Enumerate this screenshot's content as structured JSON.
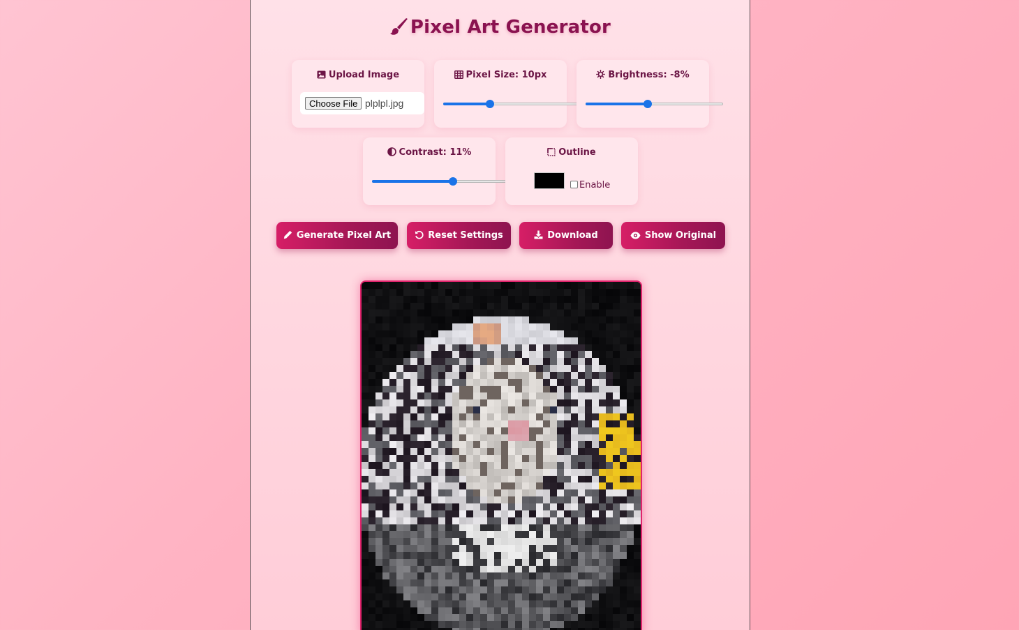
{
  "app": {
    "title": "Pixel Art Generator",
    "accent_color": "#d61e66",
    "title_icon": "paintbrush-icon"
  },
  "controls": {
    "upload": {
      "label": "Upload Image",
      "icon": "image-icon",
      "button_label": "Choose File",
      "file_name": "plplpl.jpg"
    },
    "pixel_size": {
      "label": "Pixel Size: 10px",
      "icon": "grid-icon",
      "value_fraction": 0.34
    },
    "brightness": {
      "label": "Brightness: -8%",
      "icon": "sun-icon",
      "value_fraction": 0.45
    },
    "contrast": {
      "label": "Contrast: 11%",
      "icon": "contrast-icon",
      "value_fraction": 0.59
    },
    "outline": {
      "label": "Outline",
      "icon": "outline-square-icon",
      "color": "#000000",
      "enable_label": "Enable",
      "enabled": false
    }
  },
  "actions": {
    "generate": {
      "label": "Generate Pixel Art",
      "icon": "pencil-icon"
    },
    "reset": {
      "label": "Reset Settings",
      "icon": "undo-icon"
    },
    "download": {
      "label": "Download",
      "icon": "download-icon"
    },
    "show_original": {
      "label": "Show Original",
      "icon": "eye-icon"
    }
  },
  "preview": {
    "description_name": "pixelated cat image"
  }
}
